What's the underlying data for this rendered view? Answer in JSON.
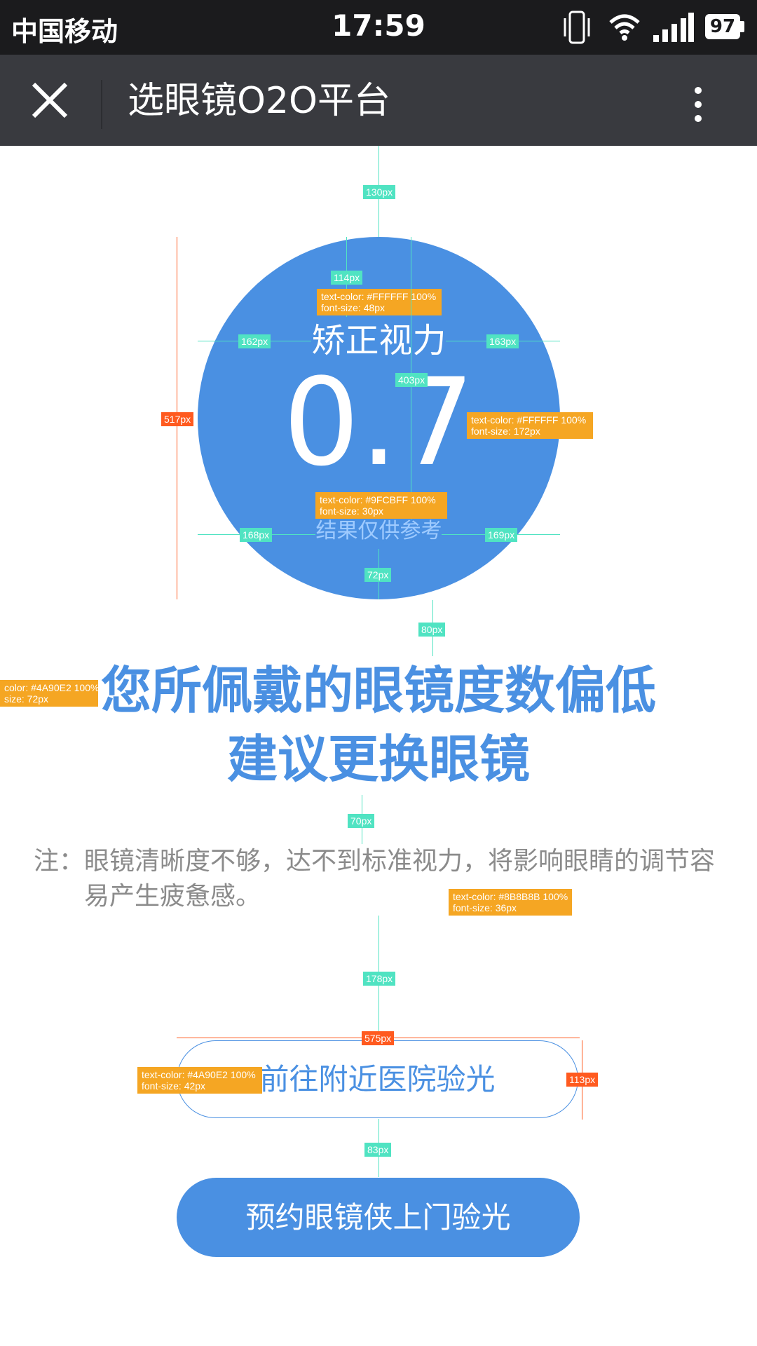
{
  "status_bar": {
    "carrier": "中国移动",
    "time": "17:59",
    "battery": "97",
    "icons": [
      "vibrate-icon",
      "wifi-icon",
      "signal-icon",
      "battery-icon"
    ]
  },
  "nav": {
    "title": "选眼镜O2O平台",
    "close_icon": "close-icon",
    "more_icon": "more-vertical-icon"
  },
  "result": {
    "label": "矫正视力",
    "value": "0.7",
    "note": "结果仅供参考"
  },
  "headline": {
    "line1": "您所佩戴的眼镜度数偏低",
    "line2": "建议更换眼镜"
  },
  "note": {
    "prefix": "注：",
    "text": "眼镜清晰度不够，达不到标准视力，将影响眼睛的调节容易产生疲惫感。"
  },
  "buttons": {
    "secondary": "前往附近医院验光",
    "primary": "预约眼镜侠上门验光"
  },
  "annotations": {
    "d130": "130px",
    "d114": "114px",
    "d162": "162px",
    "d163": "163px",
    "d403": "403px",
    "d168": "168px",
    "d169": "169px",
    "d72": "72px",
    "d80": "80px",
    "d517": "517px",
    "d70": "70px",
    "d178": "178px",
    "d575": "575px",
    "d113": "113px",
    "d83": "83px",
    "spec_label_color": "text-color: #FFFFFF 100%",
    "spec_label_size": "font-size: 48px",
    "spec_value_color": "text-color: #FFFFFF 100%",
    "spec_value_size": "font-size: 172px",
    "spec_note_color": "text-color: #9FCBFF 100%",
    "spec_note_size": "font-size: 30px",
    "spec_headline_color": "color: #4A90E2 100%",
    "spec_headline_size": "size: 72px",
    "spec_body_color": "text-color: #8B8B8B 100%",
    "spec_body_size": "font-size: 36px",
    "spec_button_color": "text-color: #4A90E2 100%",
    "spec_button_size": "font-size: 42px"
  },
  "colors": {
    "accent": "#4A90E2",
    "circle_note": "#9FCBFF",
    "body_text": "#8B8B8B",
    "status_bar": "#1B1B1D",
    "nav_bar": "#393A3F",
    "annotation_cyan": "#50E3C2",
    "annotation_orange": "#F5A623",
    "annotation_red": "#FF5A1F"
  }
}
